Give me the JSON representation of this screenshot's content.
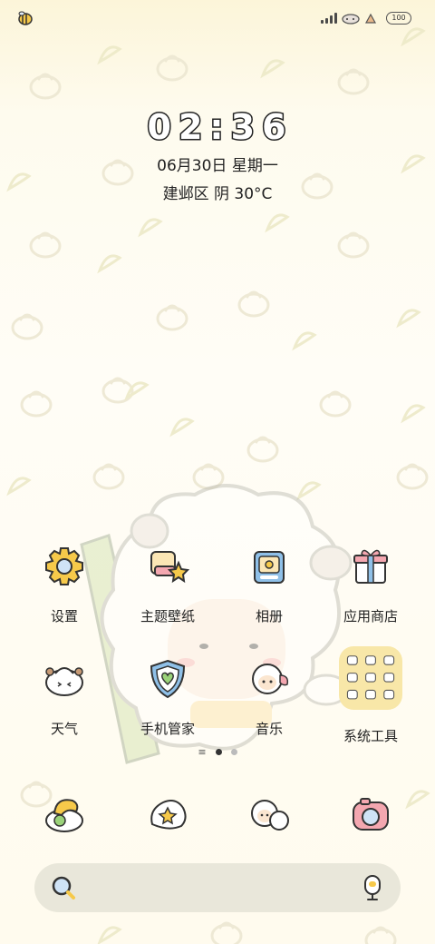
{
  "status_bar": {
    "battery": "100"
  },
  "clock": {
    "time_digits": [
      "0",
      "2",
      ":",
      "3",
      "6"
    ],
    "date": "06月30日 星期一",
    "weather": "建邺区 阴 30°C"
  },
  "apps": [
    {
      "label": "设置",
      "icon": "gear-icon"
    },
    {
      "label": "主题壁纸",
      "icon": "theme-icon"
    },
    {
      "label": "相册",
      "icon": "gallery-icon"
    },
    {
      "label": "应用商店",
      "icon": "gift-store-icon"
    },
    {
      "label": "天气",
      "icon": "weather-bun-icon"
    },
    {
      "label": "手机管家",
      "icon": "shield-heart-icon"
    },
    {
      "label": "音乐",
      "icon": "music-sheep-icon"
    },
    {
      "label": "系统工具",
      "icon": "tools-folder-icon"
    }
  ],
  "dock": [
    {
      "icon": "phone-icon"
    },
    {
      "icon": "messages-icon"
    },
    {
      "icon": "contacts-icon"
    },
    {
      "icon": "camera-icon"
    }
  ],
  "page_indicator": {
    "current": 1,
    "total": 2
  },
  "colors": {
    "accent": "#f6c94a",
    "text": "#222222"
  }
}
